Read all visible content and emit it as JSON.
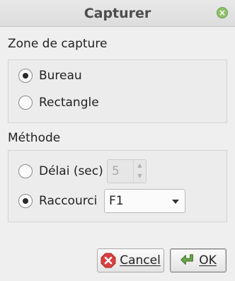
{
  "window": {
    "title": "Capturer"
  },
  "zone": {
    "label": "Zone de capture",
    "options": [
      {
        "label": "Bureau",
        "checked": true
      },
      {
        "label": "Rectangle",
        "checked": false
      }
    ]
  },
  "method": {
    "label": "Méthode",
    "delay": {
      "label": "Délai (sec)",
      "checked": false,
      "value": "5"
    },
    "shortcut": {
      "label": "Raccourci",
      "checked": true,
      "value": "F1"
    }
  },
  "buttons": {
    "cancel": "Cancel",
    "ok": "OK"
  },
  "icons": {
    "close": "close-icon",
    "cancel": "cancel-icon",
    "ok": "ok-arrow-icon"
  },
  "colors": {
    "close": "#8fc06a",
    "cancel_icon": "#d94040",
    "ok_icon": "#6fa84a"
  }
}
